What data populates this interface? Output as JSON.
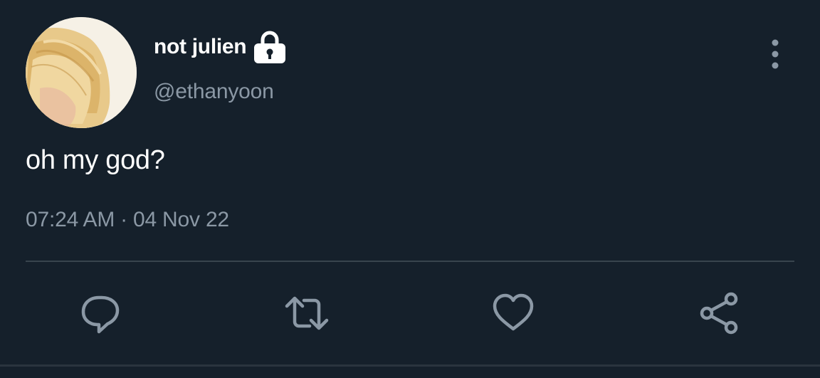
{
  "tweet": {
    "display_name": "not julien",
    "handle": "@ethanyoon",
    "text": "oh my god?",
    "time": "07:24 AM",
    "separator": "·",
    "date": "04 Nov 22"
  },
  "icons": {
    "lock": "lock-icon",
    "more": "more-vertical-icon",
    "reply": "reply-icon",
    "retweet": "retweet-icon",
    "like": "heart-icon",
    "share": "share-icon"
  },
  "colors": {
    "background": "#15202b",
    "primary_text": "#ffffff",
    "secondary_text": "#8b98a5",
    "divider": "#38444d"
  }
}
